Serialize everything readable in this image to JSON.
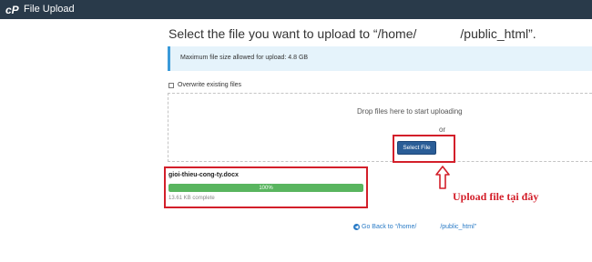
{
  "topbar": {
    "title": "File Upload",
    "logo": "cpanel-logo-icon"
  },
  "heading": {
    "prefix": "Select the file you want to upload to “/home/",
    "suffix": "/public_html”."
  },
  "info": {
    "text": "Maximum file size allowed for upload: 4.8 GB"
  },
  "overwrite": {
    "label": "Overwrite existing files",
    "checked": false
  },
  "dropzone": {
    "text": "Drop files here to start uploading",
    "or": "or",
    "button_label": "Select File"
  },
  "upload": {
    "file_name": "gioi-thieu-cong-ty.docx",
    "progress_label": "100%",
    "progress_fraction": 1.0,
    "status": "13.61 KB complete"
  },
  "annotation": {
    "text": "Upload file tại đây",
    "arrow": "up-arrow-icon"
  },
  "footer": {
    "back_prefix": "Go Back to “/home/",
    "back_suffix": "/public_html”",
    "icon": "back-arrow-icon"
  },
  "colors": {
    "topbar": "#293a4a",
    "accent_red": "#d31f2a",
    "button_blue": "#2a5d97",
    "progress_green": "#59b55f",
    "info_bg": "#e5f3fb",
    "link_blue": "#2a7bc6"
  }
}
